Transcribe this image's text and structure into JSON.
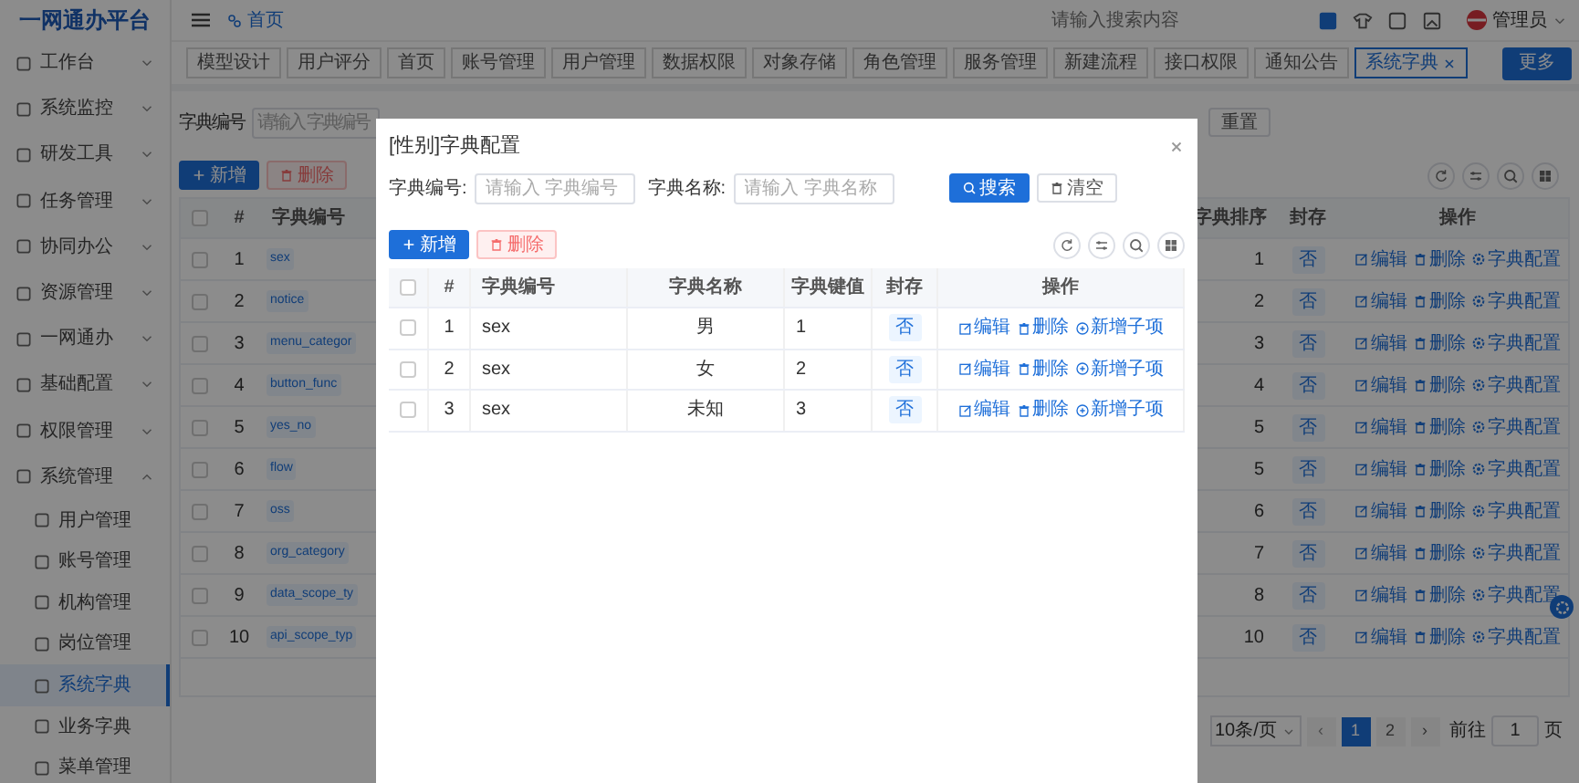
{
  "app": {
    "logo": "一网通办平台"
  },
  "sidebar": {
    "items": [
      {
        "label": "工作台",
        "expanded": false
      },
      {
        "label": "系统监控",
        "expanded": false
      },
      {
        "label": "研发工具",
        "expanded": false
      },
      {
        "label": "任务管理",
        "expanded": false
      },
      {
        "label": "协同办公",
        "expanded": false
      },
      {
        "label": "资源管理",
        "expanded": false
      },
      {
        "label": "一网通办",
        "expanded": false
      },
      {
        "label": "基础配置",
        "expanded": false
      },
      {
        "label": "权限管理",
        "expanded": false
      },
      {
        "label": "系统管理",
        "expanded": true,
        "children": [
          {
            "label": "用户管理",
            "selected": false
          },
          {
            "label": "账号管理",
            "selected": false
          },
          {
            "label": "机构管理",
            "selected": false
          },
          {
            "label": "岗位管理",
            "selected": false
          },
          {
            "label": "系统字典",
            "selected": true
          },
          {
            "label": "业务字典",
            "selected": false
          },
          {
            "label": "菜单管理",
            "selected": false
          }
        ]
      }
    ]
  },
  "topbar": {
    "breadcrumb": "首页",
    "search": {
      "placeholder": "请输入搜索内容"
    },
    "user": "管理员"
  },
  "tabs": [
    {
      "label": "模型设计",
      "selected": false,
      "closable": false
    },
    {
      "label": "用户评分",
      "selected": false,
      "closable": false
    },
    {
      "label": "首页",
      "selected": false,
      "closable": false
    },
    {
      "label": "账号管理",
      "selected": false,
      "closable": false
    },
    {
      "label": "用户管理",
      "selected": false,
      "closable": false
    },
    {
      "label": "数据权限",
      "selected": false,
      "closable": false
    },
    {
      "label": "对象存储",
      "selected": false,
      "closable": false
    },
    {
      "label": "角色管理",
      "selected": false,
      "closable": false
    },
    {
      "label": "服务管理",
      "selected": false,
      "closable": false
    },
    {
      "label": "新建流程",
      "selected": false,
      "closable": false
    },
    {
      "label": "接口权限",
      "selected": false,
      "closable": false
    },
    {
      "label": "通知公告",
      "selected": false,
      "closable": false
    },
    {
      "label": "系统字典",
      "selected": true,
      "closable": true
    }
  ],
  "more_button": "更多",
  "page": {
    "search": {
      "label": "字典编号",
      "placeholder": "请输入 字典编号"
    },
    "reset_button": "重置",
    "add_button": "新增",
    "delete_button": "删除",
    "table": {
      "all_checked": false,
      "columns": [
        "#",
        "字典编号",
        "字典排序",
        "封存",
        "操作"
      ],
      "rows": [
        {
          "index": "1",
          "code": "sex",
          "sort": "1",
          "sealed": "否",
          "checked": false,
          "actions": [
            "编辑",
            "删除",
            "字典配置"
          ]
        },
        {
          "index": "2",
          "code": "notice",
          "sort": "2",
          "sealed": "否",
          "checked": false,
          "actions": [
            "编辑",
            "删除",
            "字典配置"
          ]
        },
        {
          "index": "3",
          "code": "menu_categor",
          "sort": "3",
          "sealed": "否",
          "checked": false,
          "actions": [
            "编辑",
            "删除",
            "字典配置"
          ]
        },
        {
          "index": "4",
          "code": "button_func",
          "sort": "4",
          "sealed": "否",
          "checked": false,
          "actions": [
            "编辑",
            "删除",
            "字典配置"
          ]
        },
        {
          "index": "5",
          "code": "yes_no",
          "sort": "5",
          "sealed": "否",
          "checked": false,
          "actions": [
            "编辑",
            "删除",
            "字典配置"
          ]
        },
        {
          "index": "6",
          "code": "flow",
          "sort": "5",
          "sealed": "否",
          "checked": false,
          "actions": [
            "编辑",
            "删除",
            "字典配置"
          ]
        },
        {
          "index": "7",
          "code": "oss",
          "sort": "6",
          "sealed": "否",
          "checked": false,
          "actions": [
            "编辑",
            "删除",
            "字典配置"
          ]
        },
        {
          "index": "8",
          "code": "org_category",
          "sort": "7",
          "sealed": "否",
          "checked": false,
          "actions": [
            "编辑",
            "删除",
            "字典配置"
          ]
        },
        {
          "index": "9",
          "code": "data_scope_ty",
          "sort": "8",
          "sealed": "否",
          "checked": false,
          "actions": [
            "编辑",
            "删除",
            "字典配置"
          ]
        },
        {
          "index": "10",
          "code": "api_scope_typ",
          "sort": "10",
          "sealed": "否",
          "checked": false,
          "actions": [
            "编辑",
            "删除",
            "字典配置"
          ]
        }
      ]
    },
    "pagination": {
      "page_size": "10条/页",
      "prev": "‹",
      "pages": [
        {
          "label": "1",
          "selected": true
        },
        {
          "label": "2",
          "selected": false
        }
      ],
      "next": "›",
      "goto_label": "前往",
      "goto_value": "1",
      "goto_suffix": "页"
    }
  },
  "modal": {
    "title": "[性别]字典配置",
    "search_fields": [
      {
        "label": "字典编号:",
        "placeholder": "请输入 字典编号"
      },
      {
        "label": "字典名称:",
        "placeholder": "请输入 字典名称"
      }
    ],
    "search_button": "搜索",
    "clear_button": "清空",
    "add_button": "新增",
    "delete_button": "删除",
    "table": {
      "all_checked": false,
      "columns": [
        "#",
        "字典编号",
        "字典名称",
        "字典键值",
        "封存",
        "操作"
      ],
      "rows": [
        {
          "index": "1",
          "code": "sex",
          "name": "男",
          "key": "1",
          "sealed": "否",
          "checked": false,
          "actions": [
            "编辑",
            "删除",
            "新增子项"
          ]
        },
        {
          "index": "2",
          "code": "sex",
          "name": "女",
          "key": "2",
          "sealed": "否",
          "checked": false,
          "actions": [
            "编辑",
            "删除",
            "新增子项"
          ]
        },
        {
          "index": "3",
          "code": "sex",
          "name": "未知",
          "key": "3",
          "sealed": "否",
          "checked": false,
          "actions": [
            "编辑",
            "删除",
            "新增子项"
          ]
        }
      ]
    }
  }
}
